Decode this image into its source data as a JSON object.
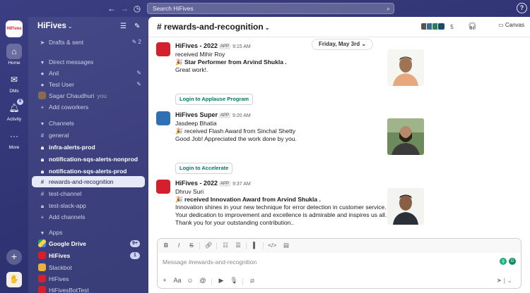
{
  "topbar": {
    "search_placeholder": "Search HiFives",
    "back": "←",
    "forward": "→",
    "history": "◷",
    "help": "?"
  },
  "rail": {
    "workspace_logo": "HiFives",
    "home_label": "Home",
    "dms_label": "DMs",
    "activity_label": "Activity",
    "activity_badge": "8",
    "more_label": "More"
  },
  "sidebar": {
    "workspace_name": "HiFives",
    "drafts": {
      "label": "Drafts & sent",
      "count": "2"
    },
    "dm_section": "Direct messages",
    "dms": [
      {
        "name": "Anil",
        "you": ""
      },
      {
        "name": "Test User",
        "you": ""
      },
      {
        "name": "Sagar Chaudhuri",
        "you": "you"
      }
    ],
    "add_coworkers": "Add coworkers",
    "channels_section": "Channels",
    "channels": [
      {
        "name": "general",
        "bold": false,
        "private": false
      },
      {
        "name": "infra-alerts-prod",
        "bold": true,
        "private": true
      },
      {
        "name": "notification-sqs-alerts-nonprod",
        "bold": true,
        "private": true
      },
      {
        "name": "notification-sqs-alerts-prod",
        "bold": true,
        "private": true
      },
      {
        "name": "rewards-and-recognition",
        "bold": false,
        "private": false,
        "active": true
      },
      {
        "name": "test-channel",
        "bold": false,
        "private": false
      },
      {
        "name": "test-slack-app",
        "bold": false,
        "private": true
      }
    ],
    "add_channels": "Add channels",
    "apps_section": "Apps",
    "apps": [
      {
        "name": "Google Drive",
        "badge": "9+"
      },
      {
        "name": "HiFives",
        "badge": "1"
      },
      {
        "name": "Slackbot",
        "badge": ""
      },
      {
        "name": "HiFives",
        "badge": ""
      },
      {
        "name": "HiFivesBotTest",
        "badge": ""
      }
    ]
  },
  "header": {
    "channel": "# rewards-and-recognition",
    "member_count": "5",
    "canvas_label": "Canvas"
  },
  "date_divider": "Friday, May 3rd",
  "messages": [
    {
      "sender": "HiFives - 2022",
      "tag": "APP",
      "time": "9:15 AM",
      "line1": "received Mihir Roy",
      "line2": "🎉  Star Performer from Arvind Shukla .",
      "line3": "Great work!.",
      "button": "Login to Applause Program"
    },
    {
      "sender": "HiFives Super",
      "tag": "APP",
      "time": "9:20 AM",
      "line1": "Jasdeep Bhatia",
      "line2": "🎉  received Flash Award from Sinchal Shetty",
      "line3": "Good Job! Appreciated the work done by you.",
      "button": "Login to Accelerate"
    },
    {
      "sender": "HiFives - 2022",
      "tag": "APP",
      "time": "9:37 AM",
      "line1": "Dhruv Suri",
      "line2": "🎉  received Innovation Award from Arvind Shukla .",
      "line3": "Innovation shines in your new technique for error detection in customer service. Your dedication to improvement and excellence is admirable and inspires us all. Thank you for your outstanding contribution.."
    }
  ],
  "composer": {
    "placeholder": "Message #rewards-and-recognition"
  }
}
